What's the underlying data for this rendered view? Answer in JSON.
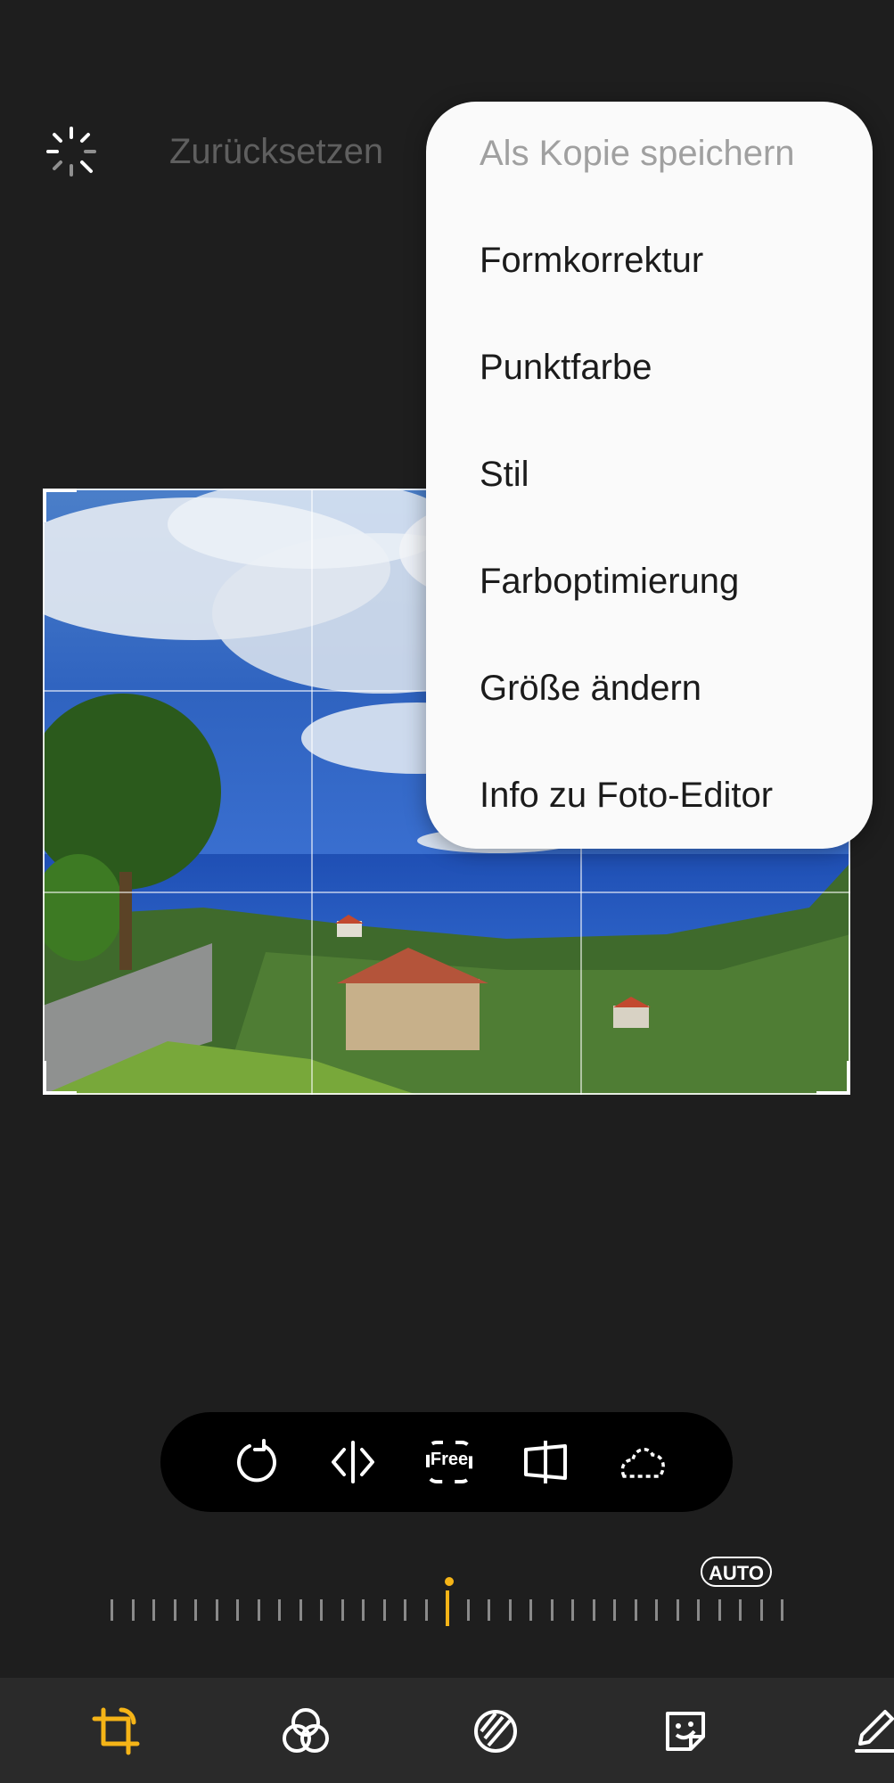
{
  "header": {
    "reset_label": "Zurücksetzen",
    "auto_enhance_icon": "magic-wand-icon"
  },
  "overflow_menu": {
    "items": [
      {
        "label": "Als Kopie speichern",
        "enabled": false
      },
      {
        "label": "Formkorrektur",
        "enabled": true
      },
      {
        "label": "Punktfarbe",
        "enabled": true
      },
      {
        "label": "Stil",
        "enabled": true
      },
      {
        "label": "Farboptimierung",
        "enabled": true
      },
      {
        "label": "Größe ändern",
        "enabled": true
      },
      {
        "label": "Info zu Foto-Editor",
        "enabled": true
      }
    ]
  },
  "crop_tools": {
    "icons": [
      "rotate-icon",
      "flip-icon",
      "free-ratio-icon",
      "perspective-icon",
      "lasso-icon"
    ],
    "free_label": "Free"
  },
  "straighten": {
    "auto_label": "AUTO",
    "value": 0
  },
  "bottom_nav": {
    "icons": [
      "crop-transform-icon",
      "filters-icon",
      "tone-icon",
      "sticker-icon",
      "draw-icon"
    ],
    "active_index": 0
  },
  "colors": {
    "accent": "#f5b417",
    "background": "#1e1e1e",
    "menu_bg": "#fafafa"
  }
}
